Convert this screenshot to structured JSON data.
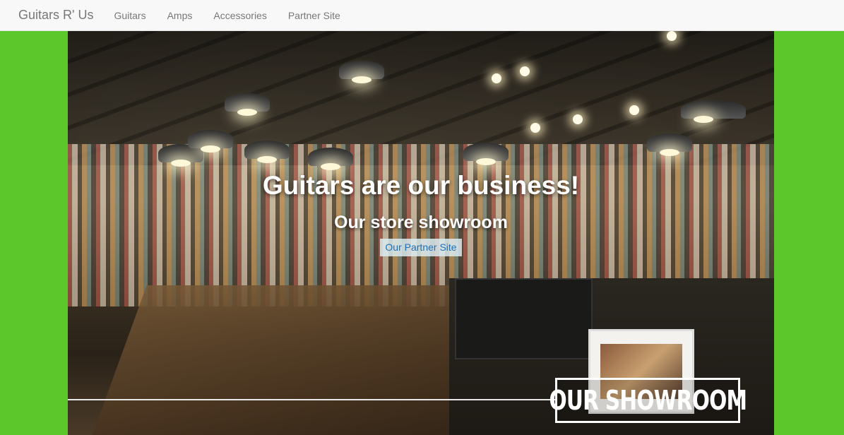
{
  "navbar": {
    "brand": "Guitars R' Us",
    "links": [
      {
        "label": "Guitars"
      },
      {
        "label": "Amps"
      },
      {
        "label": "Accessories"
      },
      {
        "label": "Partner Site"
      }
    ]
  },
  "hero": {
    "title": "Guitars are our business!",
    "subtitle": "Our store showroom",
    "partner_button": "Our Partner Site",
    "badge": "OUR SHOWROOM",
    "image_alt": "Guitar store showroom interior"
  },
  "colors": {
    "page_background": "#5bc72a",
    "navbar_background": "#f8f8f8",
    "nav_text": "#777777",
    "button_text": "#1f6fb5"
  }
}
